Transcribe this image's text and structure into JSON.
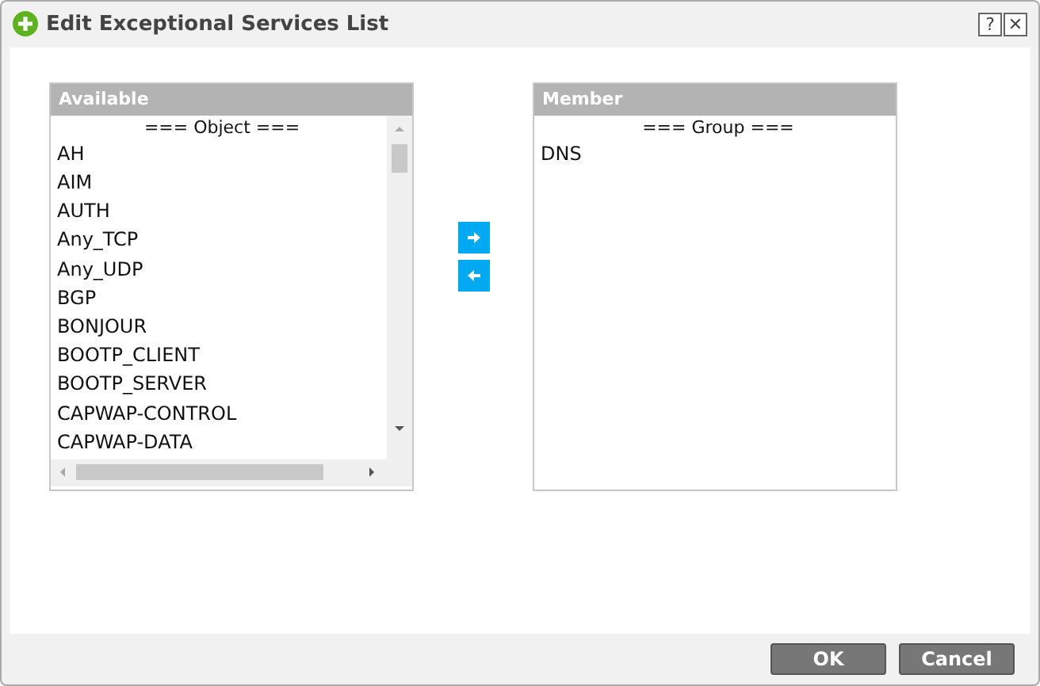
{
  "window": {
    "title": "Edit Exceptional Services List",
    "help": "?",
    "close": "✕"
  },
  "available": {
    "title": "Available",
    "group_header": "=== Object ===",
    "items": [
      {
        "label": "AH",
        "selected": false
      },
      {
        "label": "AIM",
        "selected": false
      },
      {
        "label": "AUTH",
        "selected": false
      },
      {
        "label": "Any_TCP",
        "selected": false
      },
      {
        "label": "Any_UDP",
        "selected": false
      },
      {
        "label": "BGP",
        "selected": false
      },
      {
        "label": "BONJOUR",
        "selected": false
      },
      {
        "label": "BOOTP_CLIENT",
        "selected": false
      },
      {
        "label": "BOOTP_SERVER",
        "selected": false
      },
      {
        "label": "CAPWAP-CONTROL",
        "selected": false
      },
      {
        "label": "CAPWAP-DATA",
        "selected": false
      }
    ]
  },
  "member": {
    "title": "Member",
    "group_header": "=== Group ===",
    "items": [
      {
        "label": "DNS",
        "selected": false
      }
    ]
  },
  "buttons": [
    "OK",
    "Cancel"
  ]
}
